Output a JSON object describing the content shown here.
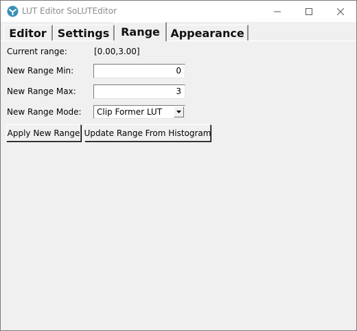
{
  "window": {
    "title": "LUT Editor SoLUTEditor",
    "app_icon": "app-logo-icon",
    "controls": [
      "minimize-icon",
      "maximize-icon",
      "close-icon"
    ]
  },
  "tabs": [
    {
      "label": "Editor",
      "selected": false
    },
    {
      "label": "Settings",
      "selected": false
    },
    {
      "label": "Range",
      "selected": true
    },
    {
      "label": "Appearance",
      "selected": false
    }
  ],
  "range": {
    "current_label": "Current range:",
    "current_value": "[0.00,3.00]",
    "min_label": "New Range Min:",
    "min_value": "0",
    "max_label": "New Range Max:",
    "max_value": "3",
    "mode_label": "New Range Mode:",
    "mode_value": "Clip Former LUT",
    "apply_button": "Apply New Range",
    "update_button": "Update Range From Histogram"
  },
  "colors": {
    "background": "#f0f0f0",
    "icon_accent": "#3a8fb7"
  }
}
